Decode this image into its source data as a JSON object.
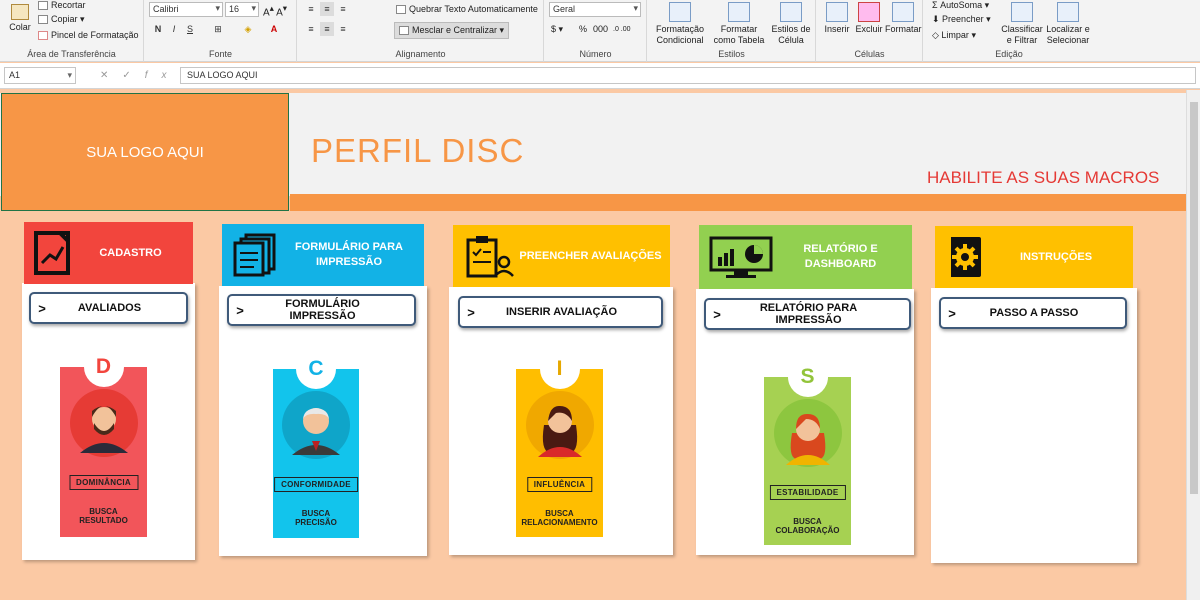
{
  "ribbon": {
    "clipboard": {
      "title": "Área de Transferência",
      "paste": "Colar",
      "cut": "Recortar",
      "copy": "Copiar",
      "format_painter": "Pincel de Formatação"
    },
    "font": {
      "title": "Fonte",
      "name": "Calibri",
      "size": "16",
      "bold": "N",
      "italic": "I",
      "underline": "S"
    },
    "alignment": {
      "title": "Alignamento",
      "wrap": "Quebrar Texto Automaticamente",
      "merge": "Mesclar e Centralizar"
    },
    "number": {
      "title": "Número",
      "format": "Geral",
      "percent": "%",
      "thousands": "000"
    },
    "styles": {
      "title": "Estilos",
      "conditional": "Formatação Condicional",
      "format_table": "Formatar como Tabela",
      "cell_styles": "Estilos de Célula"
    },
    "cells": {
      "title": "Células",
      "insert": "Inserir",
      "delete": "Excluir",
      "format": "Formatar"
    },
    "editing": {
      "title": "Edição",
      "autosum": "AutoSoma",
      "fill": "Preencher",
      "clear": "Limpar",
      "sort": "Classificar e Filtrar",
      "find": "Localizar e Selecionar"
    }
  },
  "formula_bar": {
    "cell_ref": "A1",
    "fx": "fx",
    "content": "SUA LOGO AQUI"
  },
  "sheet": {
    "logo": "SUA LOGO AQUI",
    "title": "PERFIL DISC",
    "macro_notice": "HABILITE AS SUAS MACROS",
    "cards": [
      {
        "header": "CADASTRO",
        "button": "AVALIADOS",
        "letter": "D",
        "tag": "DOMINÂNCIA",
        "desc1": "BUSCA",
        "desc2": "RESULTADO",
        "color": "#f2453d",
        "icon": "chart-document-icon"
      },
      {
        "header": "FORMULÁRIO PARA IMPRESSÃO",
        "button": "FORMULÁRIO IMPRESSÃO",
        "letter": "C",
        "tag": "CONFORMIDADE",
        "desc1": "BUSCA",
        "desc2": "PRECISÃO",
        "color": "#12b2e6",
        "icon": "stacked-documents-icon"
      },
      {
        "header": "PREENCHER AVALIAÇÕES",
        "button": "INSERIR AVALIAÇÃO",
        "letter": "I",
        "tag": "INFLUÊNCIA",
        "desc1": "BUSCA",
        "desc2": "RELACIONAMENTO",
        "color": "#ffc000",
        "icon": "clipboard-user-icon"
      },
      {
        "header": "RELATÓRIO E DASHBOARD",
        "button": "RELATÓRIO PARA IMPRESSÃO",
        "letter": "S",
        "tag": "ESTABILIDADE",
        "desc1": "BUSCA",
        "desc2": "COLABORAÇÃO",
        "color": "#92d050",
        "icon": "dashboard-monitor-icon"
      },
      {
        "header": "INSTRUÇÕES",
        "button": "PASSO A PASSO",
        "color": "#ffc000",
        "icon": "gear-book-icon"
      }
    ]
  }
}
